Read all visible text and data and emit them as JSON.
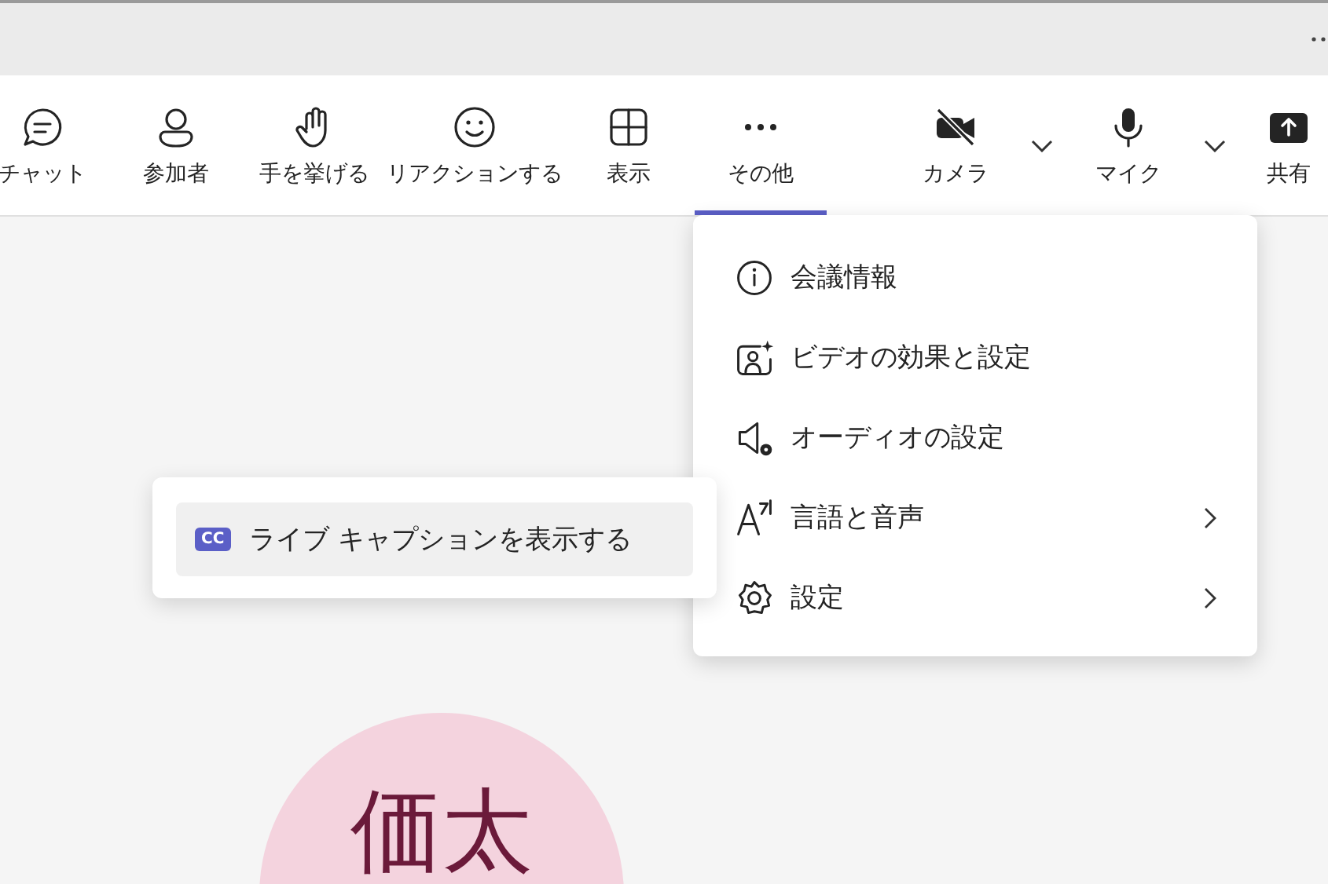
{
  "toolbar": {
    "items": [
      {
        "kind": "button",
        "label": "チャット",
        "selected": false
      },
      {
        "kind": "button",
        "label": "参加者",
        "selected": false
      },
      {
        "kind": "button",
        "label": "手を挙げる",
        "selected": false
      },
      {
        "kind": "button",
        "label": "リアクションする",
        "selected": false
      },
      {
        "kind": "button",
        "label": "表示",
        "selected": false
      },
      {
        "kind": "button",
        "label": "その他",
        "selected": true
      },
      {
        "kind": "divider"
      },
      {
        "kind": "device",
        "label": "カメラ",
        "on": false
      },
      {
        "kind": "dropdown"
      },
      {
        "kind": "device",
        "label": "マイク",
        "on": true
      },
      {
        "kind": "dropdown"
      },
      {
        "kind": "button",
        "label": "共有",
        "selected": false
      }
    ]
  },
  "more_menu": {
    "items": [
      {
        "label": "会議情報",
        "has_submenu": false
      },
      {
        "label": "ビデオの効果と設定",
        "has_submenu": false
      },
      {
        "label": "オーディオの設定",
        "has_submenu": false
      },
      {
        "label": "言語と音声",
        "has_submenu": true
      },
      {
        "label": "設定",
        "has_submenu": true
      }
    ]
  },
  "submenu": {
    "items": [
      {
        "label": "ライブ キャプションを表示する",
        "badge": "CC",
        "highlighted": true
      }
    ]
  },
  "avatar": {
    "initials": "価太"
  }
}
